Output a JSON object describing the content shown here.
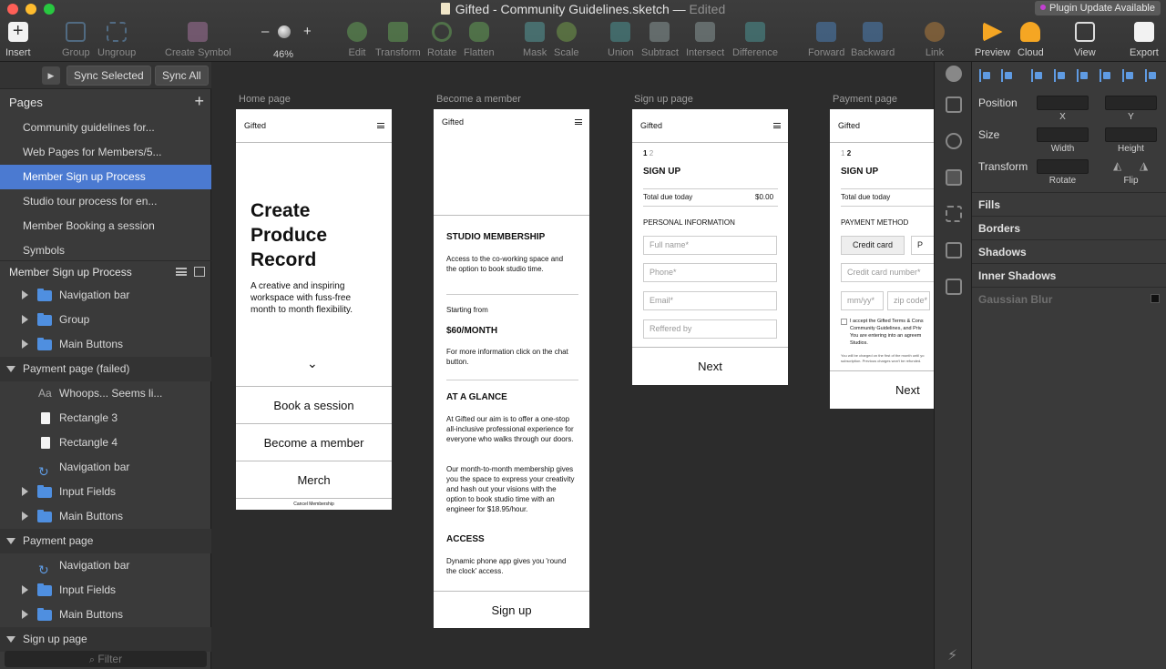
{
  "window": {
    "title": "Gifted - Community Guidelines.sketch",
    "title_separator": "—",
    "status": "Edited",
    "plugin_badge": "Plugin Update Available",
    "colors": {
      "accent": "#4b7ad1",
      "folder": "#4f8fe0",
      "plugin_dot": "#c23fd1"
    }
  },
  "toolbar": {
    "insert": "Insert",
    "group": "Group",
    "ungroup": "Ungroup",
    "create_symbol": "Create Symbol",
    "zoom_minus": "–",
    "zoom_plus": "+",
    "zoom_level": "46%",
    "edit": "Edit",
    "transform": "Transform",
    "rotate": "Rotate",
    "flatten": "Flatten",
    "mask": "Mask",
    "scale": "Scale",
    "union": "Union",
    "subtract": "Subtract",
    "intersect": "Intersect",
    "difference": "Difference",
    "forward": "Forward",
    "backward": "Backward",
    "link": "Link",
    "preview": "Preview",
    "cloud": "Cloud",
    "view": "View",
    "export": "Export"
  },
  "left_panel": {
    "play": "▶",
    "sync_selected": "Sync Selected",
    "sync_all": "Sync All",
    "pages_title": "Pages",
    "add_page": "+",
    "pages": [
      "Community guidelines for...",
      "Web Pages for Members/5...",
      "Member Sign up Process",
      "Studio tour process for en...",
      "Member Booking a session",
      "Symbols"
    ],
    "layers_title": "Member Sign up Process",
    "layers": [
      "Navigation bar",
      "Group",
      "Main Buttons",
      "Payment page (failed)",
      "Whoops... Seems li...",
      "Rectangle 3",
      "Rectangle 4",
      "Navigation bar",
      "Input Fields",
      "Main Buttons",
      "Payment page",
      "Navigation bar",
      "Input Fields",
      "Main Buttons",
      "Sign up page"
    ],
    "text_layer_icon": "Aa",
    "filter_placeholder": "Filter"
  },
  "canvas": {
    "labels": [
      "Home page",
      "Become a member",
      "Sign up page",
      "Payment page"
    ],
    "home": {
      "brand": "Gifted",
      "headline_1": "Create",
      "headline_2": "Produce",
      "headline_3": "Record",
      "body": "A creative and inspiring workspace with fuss-free month to month flexibility.",
      "chevron": "⌄",
      "btn_book": "Book a session",
      "btn_member": "Become a member",
      "btn_merch": "Merch",
      "footer": "Cancel Membership"
    },
    "member": {
      "brand": "Gifted",
      "h_membership": "STUDIO MEMBERSHIP",
      "p_membership": "Access to the co-working space and the option to book studio time.",
      "starting_from": "Starting from",
      "price": "$60/MONTH",
      "p_info": "For more information click on the chat button.",
      "h_glance": "AT A GLANCE",
      "p_glance_1": "At Gifted our aim is to offer a one-stop all-inclusive professional experience for everyone who walks through our doors.",
      "p_glance_2": "Our month-to-month membership gives you the space to express your creativity and hash out your visions with the option to book studio time with an engineer for $18.95/hour.",
      "h_access": "ACCESS",
      "p_access": "Dynamic phone app gives you 'round the clock' access.",
      "btn_signup": "Sign up"
    },
    "signup": {
      "brand": "Gifted",
      "step_current": "1",
      "step_next": "2",
      "title": "SIGN UP",
      "total_label": "Total due today",
      "total_value": "$0.00",
      "section": "PERSONAL INFORMATION",
      "fields": [
        "Full name*",
        "Phone*",
        "Email*",
        "Reffered by"
      ],
      "btn_next": "Next"
    },
    "payment": {
      "brand": "Gifted",
      "step_prev": "1",
      "step_current": "2",
      "title": "SIGN UP",
      "total_label": "Total due today",
      "section": "PAYMENT METHOD",
      "method_1": "Credit card",
      "method_2": "P",
      "field_card": "Credit card number*",
      "field_date": "mm/yy*",
      "field_zip": "zip code*",
      "terms_1": "I accept the Gifted Terms & Cons",
      "terms_2": "Community Guidelines, and Priv",
      "terms_3": "You are entering into an agreem",
      "terms_4": "Studios.",
      "fine_1": "You will be charged on the first of the month until yo",
      "fine_2": "subscription. Previous charges won't be refunded.",
      "btn_next": "Next"
    }
  },
  "inspector": {
    "position": "Position",
    "x": "X",
    "y": "Y",
    "size": "Size",
    "width": "Width",
    "height": "Height",
    "transform": "Transform",
    "rotate": "Rotate",
    "flip": "Flip",
    "sections": [
      "Fills",
      "Borders",
      "Shadows",
      "Inner Shadows",
      "Gaussian Blur"
    ]
  }
}
